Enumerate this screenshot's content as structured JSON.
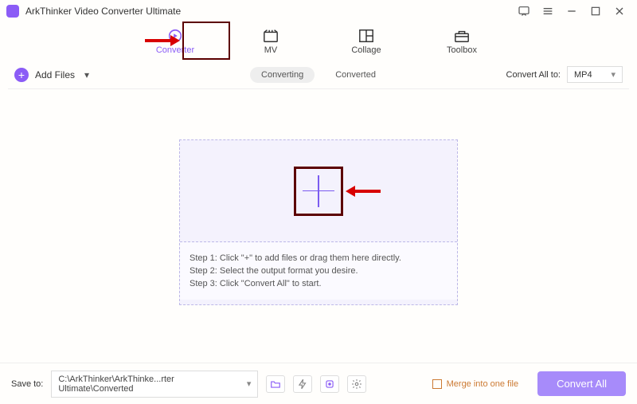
{
  "app": {
    "title": "ArkThinker Video Converter Ultimate"
  },
  "tabs": {
    "converter": "Converter",
    "mv": "MV",
    "collage": "Collage",
    "toolbox": "Toolbox"
  },
  "toolbar": {
    "add_files": "Add Files",
    "converting": "Converting",
    "converted": "Converted",
    "convert_all_to": "Convert All to:",
    "format": "MP4"
  },
  "steps": {
    "s1": "Step 1: Click \"+\" to add files or drag them here directly.",
    "s2": "Step 2: Select the output format you desire.",
    "s3": "Step 3: Click \"Convert All\" to start."
  },
  "bottom": {
    "save_to": "Save to:",
    "path": "C:\\ArkThinker\\ArkThinke...rter Ultimate\\Converted",
    "merge": "Merge into one file",
    "convert_all": "Convert All"
  }
}
